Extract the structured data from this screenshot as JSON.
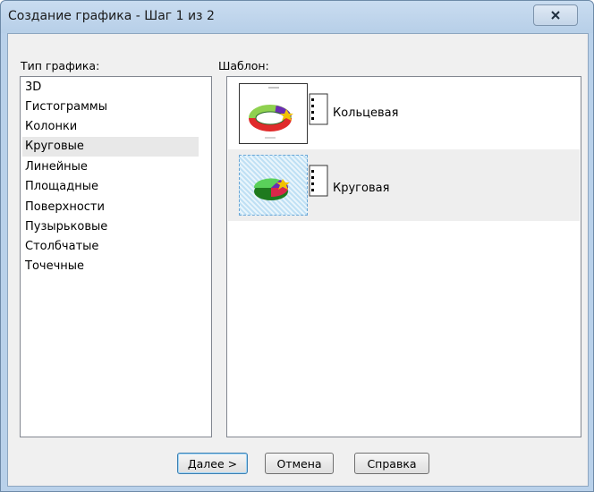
{
  "window": {
    "title": "Создание графика - Шаг 1 из 2"
  },
  "left": {
    "label": "Тип графика:",
    "items": [
      "3D",
      "Гистограммы",
      "Колонки",
      "Круговые",
      "Линейные",
      "Площадные",
      "Поверхности",
      "Пузырьковые",
      "Столбчатые",
      "Точечные"
    ],
    "selected": "Круговые"
  },
  "right": {
    "label": "Шаблон:",
    "templates": [
      {
        "name": "Кольцевая",
        "icon": "donut-chart-icon"
      },
      {
        "name": "Круговая",
        "icon": "pie-chart-icon"
      }
    ],
    "selected": "Круговая"
  },
  "buttons": {
    "next": "Далее >",
    "cancel": "Отмена",
    "help": "Справка"
  }
}
